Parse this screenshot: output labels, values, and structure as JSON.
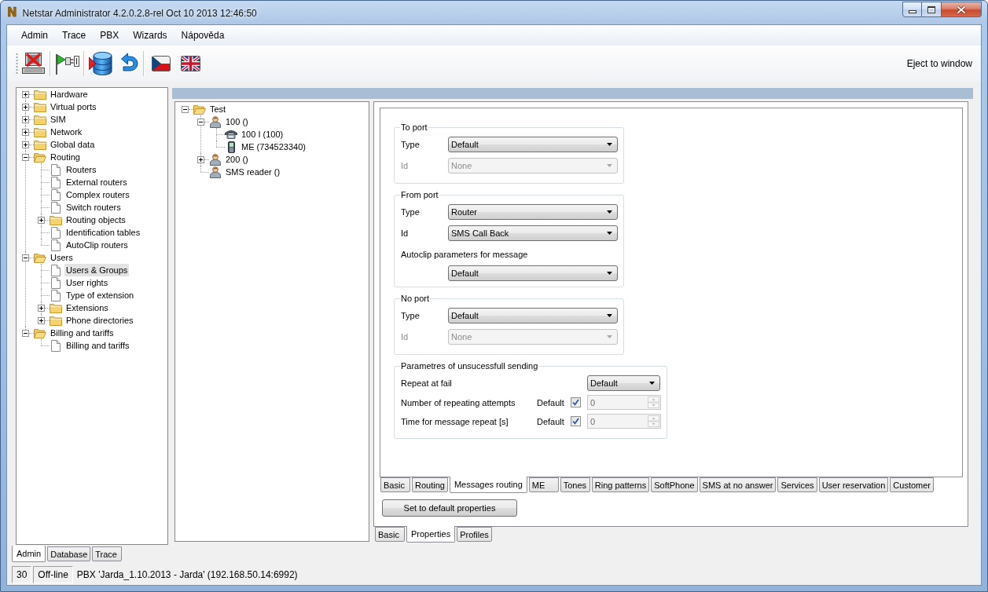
{
  "window": {
    "logo": "N",
    "title": "Netstar Administrator 4.2.0.2.8-rel Oct 10 2013 12:46:50"
  },
  "menu": [
    "Admin",
    "Trace",
    "PBX",
    "Wizards",
    "Nápověda"
  ],
  "toolbar": {
    "eject_button": "Eject to window"
  },
  "nav_tree": [
    {
      "label": "Hardware",
      "kind": "folder",
      "expanded": false,
      "selected": false
    },
    {
      "label": "Virtual ports",
      "kind": "folder",
      "expanded": false,
      "selected": false
    },
    {
      "label": "SIM",
      "kind": "folder",
      "expanded": false,
      "selected": false
    },
    {
      "label": "Network",
      "kind": "folder",
      "expanded": false,
      "selected": false
    },
    {
      "label": "Global data",
      "kind": "folder",
      "expanded": false,
      "selected": false
    },
    {
      "label": "Routing",
      "kind": "folder",
      "expanded": true,
      "selected": false,
      "children": [
        {
          "label": "Routers",
          "kind": "document",
          "selected": false
        },
        {
          "label": "External routers",
          "kind": "document",
          "selected": false
        },
        {
          "label": "Complex routers",
          "kind": "document",
          "selected": false
        },
        {
          "label": "Switch routers",
          "kind": "document",
          "selected": false
        },
        {
          "label": "Routing objects",
          "kind": "folder",
          "expanded": false,
          "selected": false
        },
        {
          "label": "Identification tables",
          "kind": "document",
          "selected": false
        },
        {
          "label": "AutoClip routers",
          "kind": "document",
          "selected": false
        }
      ]
    },
    {
      "label": "Users",
      "kind": "folder",
      "expanded": true,
      "selected": false,
      "children": [
        {
          "label": "Users & Groups",
          "kind": "document",
          "selected": true
        },
        {
          "label": "User rights",
          "kind": "document",
          "selected": false
        },
        {
          "label": "Type of extension",
          "kind": "document",
          "selected": false
        },
        {
          "label": "Extensions",
          "kind": "folder",
          "expanded": false,
          "selected": false
        },
        {
          "label": "Phone directories",
          "kind": "folder",
          "expanded": false,
          "selected": false
        }
      ]
    },
    {
      "label": "Billing and tariffs",
      "kind": "folder",
      "expanded": true,
      "selected": false,
      "children": [
        {
          "label": "Billing and tariffs",
          "kind": "document",
          "selected": false
        }
      ]
    }
  ],
  "users_tree": [
    {
      "label": "Test",
      "kind": "folder",
      "expanded": true,
      "selected": false,
      "children": [
        {
          "label": "100 ()",
          "kind": "user",
          "expanded": true,
          "selected": false,
          "children": [
            {
              "label": "100 I (100)",
              "kind": "phone",
              "selected": false
            },
            {
              "label": "ME (734523340)",
              "kind": "mobile",
              "selected": false
            }
          ]
        },
        {
          "label": "200 ()",
          "kind": "user",
          "expanded": false,
          "selected": false
        },
        {
          "label": "SMS reader ()",
          "kind": "user",
          "selected": false
        }
      ]
    }
  ],
  "form": {
    "groups": [
      {
        "kind": "port",
        "title": "To port",
        "rows": [
          {
            "kind": "combo",
            "label": "Type",
            "value": "Default",
            "disabled": false
          },
          {
            "kind": "combo",
            "label": "Id",
            "value": "None",
            "disabled": true
          }
        ]
      },
      {
        "kind": "port",
        "title": "From port",
        "rows": [
          {
            "kind": "combo",
            "label": "Type",
            "value": "Router",
            "disabled": false
          },
          {
            "kind": "combo",
            "label": "Id",
            "value": "SMS Call Back",
            "disabled": false
          },
          {
            "kind": "stacked_combo",
            "label": "Autoclip parameters for message",
            "value": "Default",
            "disabled": false
          }
        ]
      },
      {
        "kind": "port",
        "title": "No port",
        "rows": [
          {
            "kind": "combo",
            "label": "Type",
            "value": "Default",
            "disabled": false
          },
          {
            "kind": "combo",
            "label": "Id",
            "value": "None",
            "disabled": true
          }
        ]
      },
      {
        "kind": "retry",
        "title": "Parametres of unsucessfull sending",
        "rows": [
          {
            "kind": "combo",
            "label": "Repeat at fail",
            "value": "Default",
            "disabled": false
          },
          {
            "kind": "spin",
            "label": "Number of repeating attempts",
            "default_label": "Default",
            "default_checked": true,
            "value": "0"
          },
          {
            "kind": "spin",
            "label": "Time for message repeat [s]",
            "default_label": "Default",
            "default_checked": true,
            "value": "0"
          }
        ]
      }
    ]
  },
  "property_tabs": [
    {
      "label": "Basic",
      "selected": false
    },
    {
      "label": "Routing",
      "selected": false
    },
    {
      "label": "Messages routing",
      "selected": true
    },
    {
      "label": "ME",
      "selected": false
    },
    {
      "label": "Tones",
      "selected": false
    },
    {
      "label": "Ring patterns",
      "selected": false
    },
    {
      "label": "SoftPhone",
      "selected": false
    },
    {
      "label": "SMS at no answer",
      "selected": false
    },
    {
      "label": "Services",
      "selected": false
    },
    {
      "label": "User reservation",
      "selected": false
    },
    {
      "label": "Customer",
      "selected": false
    }
  ],
  "default_button": "Set to default properties",
  "view_tabs": [
    {
      "label": "Basic",
      "selected": false
    },
    {
      "label": "Properties",
      "selected": true
    },
    {
      "label": "Profiles",
      "selected": false
    }
  ],
  "side_tabs": [
    {
      "label": "Admin",
      "selected": true
    },
    {
      "label": "Database",
      "selected": false
    },
    {
      "label": "Trace",
      "selected": false
    }
  ],
  "status_bar": {
    "cells": [
      "30",
      "Off-line"
    ],
    "message": "PBX 'Jarda_1.10.2013 - Jarda' (192.168.50.14:6992)"
  }
}
